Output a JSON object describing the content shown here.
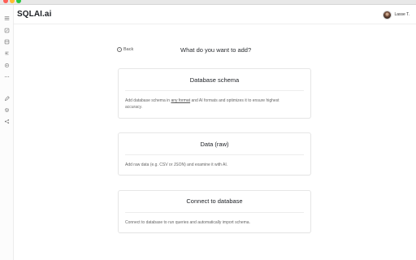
{
  "app": {
    "title": "SQLAI.ai"
  },
  "user": {
    "name": "Lasse T."
  },
  "sidebar": {
    "items": [
      {
        "icon": "hamburger-menu-icon"
      },
      {
        "icon": "edit-icon"
      },
      {
        "icon": "database-icon"
      },
      {
        "icon": "list-icon"
      },
      {
        "icon": "settings-icon"
      },
      {
        "icon": "more-icon"
      },
      {
        "icon": "pen-icon"
      },
      {
        "icon": "gear-icon"
      },
      {
        "icon": "share-icon"
      }
    ]
  },
  "nav": {
    "back_label": "Back"
  },
  "page": {
    "title": "What do you want to add?"
  },
  "options": [
    {
      "title": "Database schema",
      "desc_prefix": "Add database schema in ",
      "desc_link": "any format",
      "desc_suffix": " and AI formats and optimizes it to ensure highest accuracy."
    },
    {
      "title": "Data (raw)",
      "desc": "Add raw data (e.g. CSV or JSON) and examine it with AI."
    },
    {
      "title": "Connect to database",
      "desc": "Connect to database to run queries and automatically import schema."
    }
  ]
}
